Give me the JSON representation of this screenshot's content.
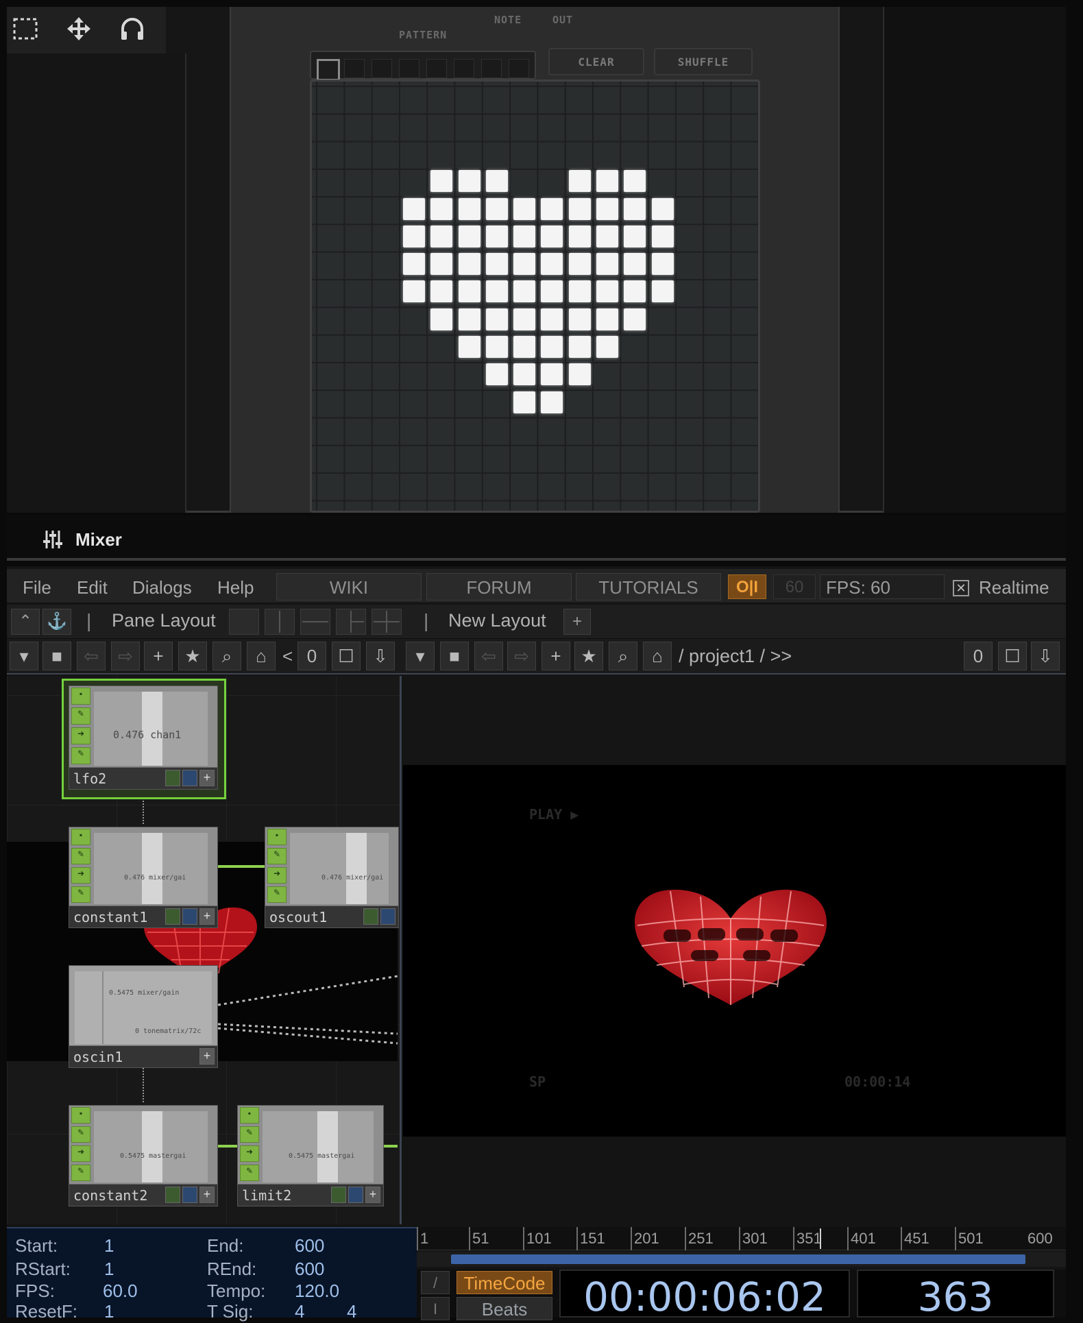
{
  "toolbar": {
    "icons": [
      "marquee-select-icon",
      "move-arrows-icon",
      "headphones-icon"
    ]
  },
  "plugin": {
    "labels": {
      "note": "NOTE",
      "out": "OUT",
      "pattern": "PATTERN"
    },
    "buttons": {
      "clear": "CLEAR",
      "shuffle": "SHUFFLE"
    },
    "grid": {
      "columns": 16,
      "rows": 16,
      "active_cells": [
        [
          4,
          4
        ],
        [
          5,
          4
        ],
        [
          6,
          4
        ],
        [
          9,
          4
        ],
        [
          10,
          4
        ],
        [
          11,
          4
        ],
        [
          3,
          5
        ],
        [
          4,
          5
        ],
        [
          5,
          5
        ],
        [
          6,
          5
        ],
        [
          7,
          5
        ],
        [
          8,
          5
        ],
        [
          9,
          5
        ],
        [
          10,
          5
        ],
        [
          11,
          5
        ],
        [
          12,
          5
        ],
        [
          3,
          6
        ],
        [
          4,
          6
        ],
        [
          5,
          6
        ],
        [
          6,
          6
        ],
        [
          7,
          6
        ],
        [
          8,
          6
        ],
        [
          9,
          6
        ],
        [
          10,
          6
        ],
        [
          11,
          6
        ],
        [
          12,
          6
        ],
        [
          3,
          7
        ],
        [
          4,
          7
        ],
        [
          5,
          7
        ],
        [
          6,
          7
        ],
        [
          7,
          7
        ],
        [
          8,
          7
        ],
        [
          9,
          7
        ],
        [
          10,
          7
        ],
        [
          11,
          7
        ],
        [
          12,
          7
        ],
        [
          3,
          8
        ],
        [
          4,
          8
        ],
        [
          5,
          8
        ],
        [
          6,
          8
        ],
        [
          7,
          8
        ],
        [
          8,
          8
        ],
        [
          9,
          8
        ],
        [
          10,
          8
        ],
        [
          11,
          8
        ],
        [
          12,
          8
        ],
        [
          4,
          9
        ],
        [
          5,
          9
        ],
        [
          6,
          9
        ],
        [
          7,
          9
        ],
        [
          8,
          9
        ],
        [
          9,
          9
        ],
        [
          10,
          9
        ],
        [
          11,
          9
        ],
        [
          5,
          10
        ],
        [
          6,
          10
        ],
        [
          7,
          10
        ],
        [
          8,
          10
        ],
        [
          9,
          10
        ],
        [
          10,
          10
        ],
        [
          6,
          11
        ],
        [
          7,
          11
        ],
        [
          8,
          11
        ],
        [
          9,
          11
        ],
        [
          7,
          12
        ],
        [
          8,
          12
        ]
      ]
    }
  },
  "mixer": {
    "title": "Mixer",
    "icon": "sliders-icon"
  },
  "menu": {
    "items": [
      "File",
      "Edit",
      "Dialogs",
      "Help"
    ],
    "links": [
      "WIKI",
      "FORUM",
      "TUTORIALS"
    ],
    "oi": "O|I",
    "fps_target": "60",
    "fps": "FPS:  60",
    "realtime_check": "✕",
    "realtime": "Realtime"
  },
  "layout": {
    "pane_layout": "Pane Layout",
    "new_layout": "New Layout",
    "add": "+"
  },
  "nav": {
    "left_value": "0",
    "lt": "<",
    "path": "/ project1 / >>",
    "right_value": "0"
  },
  "nodes": [
    {
      "name": "lfo2",
      "value": "0.476",
      "channel": "chan1"
    },
    {
      "name": "constant1",
      "value": "0.476",
      "channel": "mixer/gai"
    },
    {
      "name": "oscout1",
      "value": "0.476",
      "channel": "mixer/gai"
    },
    {
      "name": "oscin1",
      "value": "0.5475",
      "channel": "mixer/gain",
      "value2": "0",
      "channel2": "tonematrix/72c"
    },
    {
      "name": "constant2",
      "value": "0.5475",
      "channel": "mastergai"
    },
    {
      "name": "limit2",
      "value": "0.5475",
      "channel": "mastergai"
    }
  ],
  "viewer": {
    "play": "PLAY ▶",
    "sp": "SP",
    "time": "00:00:14"
  },
  "timeline": {
    "start_label": "Start:",
    "start": "1",
    "end_label": "End:",
    "end": "600",
    "rstart_label": "RStart:",
    "rstart": "1",
    "rend_label": "REnd:",
    "rend": "600",
    "fps_label": "FPS:",
    "fps": "60.0",
    "tempo_label": "Tempo:",
    "tempo": "120.0",
    "resetf_label": "ResetF:",
    "resetf": "1",
    "tsig_label": "T Sig:",
    "tsig_a": "4",
    "tsig_b": "4",
    "ruler": [
      "1",
      "51",
      "101",
      "151",
      "201",
      "251",
      "301",
      "351",
      "401",
      "451",
      "501",
      "600"
    ],
    "timecode_btn": "TimeCode",
    "beats_btn": "Beats",
    "timecode": "00:00:06:02",
    "frame": "363"
  },
  "colors": {
    "accent_orange": "#f5a640",
    "node_green": "#8fd14f",
    "timecode_blue": "#a9c6ef"
  }
}
